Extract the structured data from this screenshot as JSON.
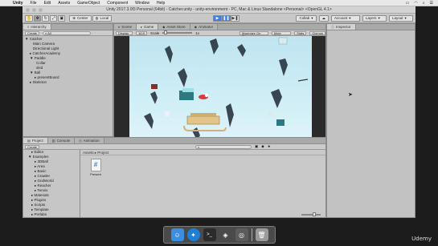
{
  "macbar": {
    "app_name": "Unity",
    "menus": [
      "File",
      "Edit",
      "Assets",
      "GameObject",
      "Component",
      "Window",
      "Help"
    ],
    "status_icons": [
      "battery-icon",
      "wifi-icon",
      "clock-icon",
      "search-icon",
      "list-icon"
    ]
  },
  "window": {
    "title": "Unity 2017.3.0f3 Personal (64bit) - Catcher.unity - unity-environment - PC, Mac & Linux Standalone <Personal> <OpenGL 4.1>"
  },
  "toolbar": {
    "tools": [
      "hand-icon",
      "move-icon",
      "rotate-icon",
      "scale-icon",
      "rect-icon"
    ],
    "pivot": "Center",
    "space": "Local",
    "collab": "Collab",
    "account": "Account",
    "layers": "Layers",
    "layout": "Layout"
  },
  "hierarchy": {
    "tab": "Hierarchy",
    "create": "Create",
    "search_placeholder": "All",
    "items": [
      {
        "label": "▼ Catcher"
      },
      {
        "label": "Main Camera"
      },
      {
        "label": "Directional Light"
      },
      {
        "label": "▸ CatcherAcademy"
      },
      {
        "label": "▼ Paddle"
      },
      {
        "label": "Collar"
      },
      {
        "label": "sled"
      },
      {
        "label": "▼ Ball"
      },
      {
        "label": "▸ presentBoard"
      },
      {
        "label": "▸ Skeleton"
      }
    ]
  },
  "scene": {
    "tabs": [
      {
        "label": "Scene",
        "icon": "#"
      },
      {
        "label": "Game",
        "icon": "▸"
      },
      {
        "label": "Asset Store",
        "icon": "◆"
      },
      {
        "label": "Animator",
        "icon": "◉"
      }
    ],
    "display": "Display 1",
    "aspect": "16:9",
    "scale_label": "Scale",
    "scale_value": "1x",
    "maximize": "Maximize On Play",
    "mute": "Mute Audio",
    "stats": "Stats",
    "gizmos": "Gizmos"
  },
  "inspector": {
    "tab": "Inspector"
  },
  "project": {
    "tabs": [
      "Project",
      "Console",
      "Animation"
    ],
    "create": "Create",
    "tree": [
      {
        "label": "▸ Editor"
      },
      {
        "label": "▼ Examples"
      },
      {
        "label": "▸ 3DBall"
      },
      {
        "label": "▸ Area"
      },
      {
        "label": "▸ Basic"
      },
      {
        "label": "▸ Crawler"
      },
      {
        "label": "▸ GridWorld"
      },
      {
        "label": "▸ Reacher"
      },
      {
        "label": "▸ Tennis"
      },
      {
        "label": "▸ Materials"
      },
      {
        "label": "▸ Plugins"
      },
      {
        "label": "▸ Scripts"
      },
      {
        "label": "▸ Template"
      },
      {
        "label": "▸ Prefabs"
      }
    ],
    "breadcrumb": "Assets ▸ Project",
    "asset": {
      "label": "Present",
      "glyph": "#"
    }
  },
  "dock": {
    "apps": [
      {
        "name": "finder-icon",
        "color": "#3b8fe0",
        "glyph": "☺"
      },
      {
        "name": "safari-icon",
        "color": "#1e7fd6",
        "glyph": "✦"
      },
      {
        "name": "terminal-icon",
        "color": "#2b2b2b",
        "glyph": ">_"
      },
      {
        "name": "unity-icon",
        "color": "#4a4a4a",
        "glyph": "◈"
      },
      {
        "name": "unity-hub-icon",
        "color": "#5c5c5c",
        "glyph": "◎"
      },
      {
        "name": "trash-icon",
        "color": "#9a9a9a",
        "glyph": "🗑"
      }
    ]
  },
  "watermark": "Udemy"
}
